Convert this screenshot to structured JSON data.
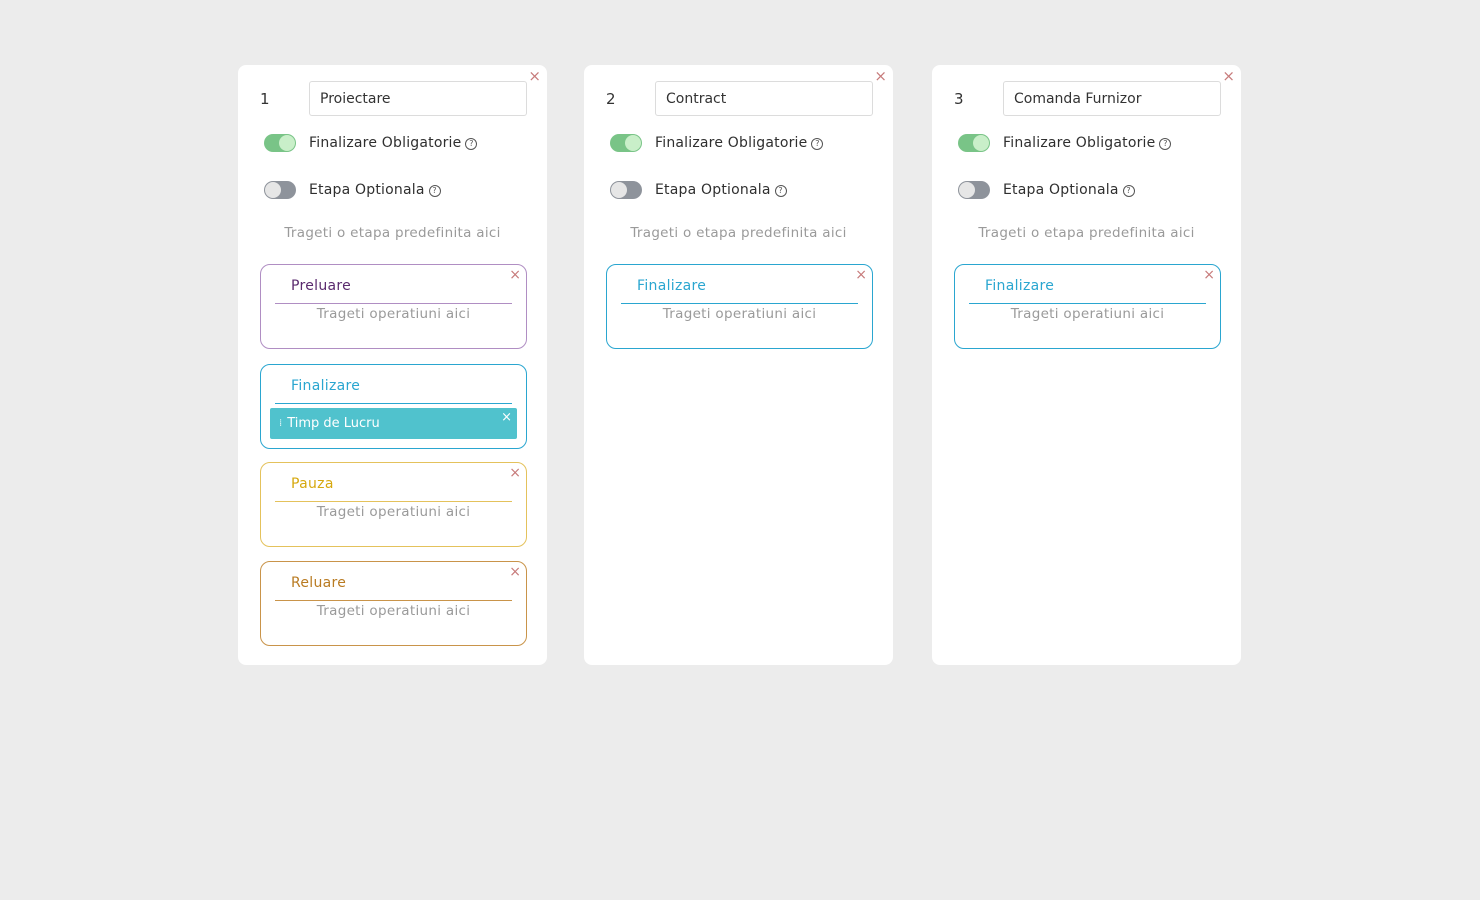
{
  "colors": {
    "background": "#ececec",
    "preluare": "#b08ec3",
    "finalizare": "#2aa6d0",
    "pauza": "#e4c25c",
    "reluare": "#c9944a",
    "toggle_on": "#79c487",
    "toggle_off": "#8e939b",
    "operation_chip": "#50c2cd",
    "close_icon": "#c77b7b"
  },
  "icons": {
    "close": "×",
    "help": "?",
    "drag_handle": "⁞"
  },
  "columns": [
    {
      "number": "1",
      "name": "Proiectare",
      "finalizare_obligatorie": {
        "label": "Finalizare Obligatorie",
        "on": true
      },
      "etapa_optionala": {
        "label": "Etapa Optionala",
        "on": false
      },
      "drop_hint": "Trageti o etapa predefinita aici",
      "stages": [
        {
          "title": "Preluare",
          "hint": "Trageti operatiuni aici",
          "color": "preluare",
          "title_color": "#5a2a6e",
          "closable": true
        },
        {
          "title": "Finalizare",
          "color": "finalizare",
          "closable": false,
          "operations": [
            {
              "label": "Timp de Lucru"
            }
          ]
        },
        {
          "title": "Pauza",
          "hint": "Trageti operatiuni aici",
          "color": "pauza",
          "title_color": "#d6a80e",
          "closable": true
        },
        {
          "title": "Reluare",
          "hint": "Trageti operatiuni aici",
          "color": "reluare",
          "title_color": "#b97b22",
          "closable": true
        }
      ]
    },
    {
      "number": "2",
      "name": "Contract",
      "finalizare_obligatorie": {
        "label": "Finalizare Obligatorie",
        "on": true
      },
      "etapa_optionala": {
        "label": "Etapa Optionala",
        "on": false
      },
      "drop_hint": "Trageti o etapa predefinita aici",
      "stages": [
        {
          "title": "Finalizare",
          "hint": "Trageti operatiuni aici",
          "color": "finalizare",
          "title_color": "#2aa6d0",
          "closable": true
        }
      ]
    },
    {
      "number": "3",
      "name": "Comanda Furnizor",
      "finalizare_obligatorie": {
        "label": "Finalizare Obligatorie",
        "on": true
      },
      "etapa_optionala": {
        "label": "Etapa Optionala",
        "on": false
      },
      "drop_hint": "Trageti o etapa predefinita aici",
      "stages": [
        {
          "title": "Finalizare",
          "hint": "Trageti operatiuni aici",
          "color": "finalizare",
          "title_color": "#2aa6d0",
          "closable": true
        }
      ]
    }
  ]
}
